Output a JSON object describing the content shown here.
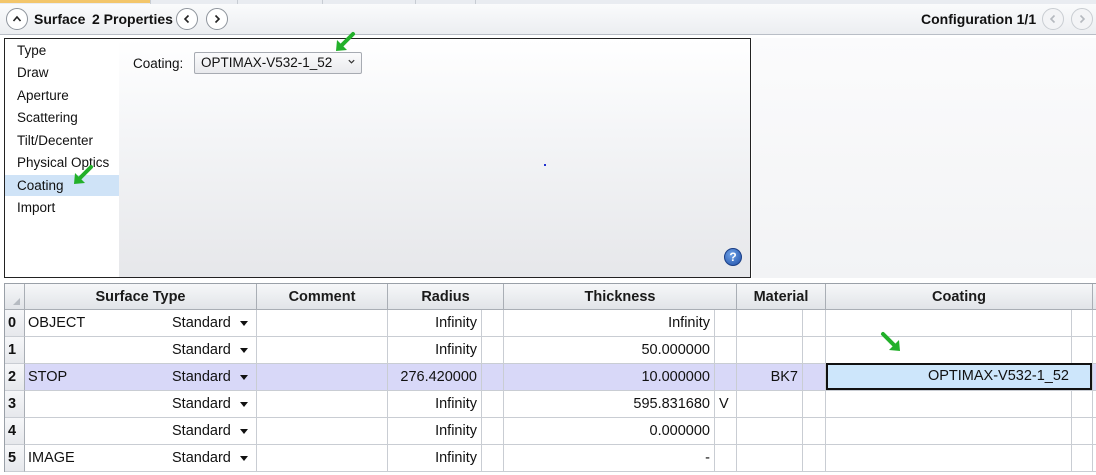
{
  "header": {
    "title": "Surface",
    "subtitle": "2 Properties",
    "configuration": "Configuration 1/1"
  },
  "nav": {
    "items": [
      "Type",
      "Draw",
      "Aperture",
      "Scattering",
      "Tilt/Decenter",
      "Physical Optics",
      "Coating",
      "Import"
    ],
    "selected": "Coating"
  },
  "coating_panel": {
    "label": "Coating:",
    "value": "OPTIMAX-V532-1_52",
    "help": "?"
  },
  "grid": {
    "columns": [
      "Surface Type",
      "Comment",
      "Radius",
      "Thickness",
      "Material",
      "Coating"
    ],
    "rows": [
      {
        "num": "0",
        "name": "OBJECT",
        "type": "Standard",
        "comment": "",
        "radius": "Infinity",
        "thickness": "Infinity",
        "solve": "",
        "material": "",
        "coating": ""
      },
      {
        "num": "1",
        "name": "",
        "type": "Standard",
        "comment": "",
        "radius": "Infinity",
        "thickness": "50.000000",
        "solve": "",
        "material": "",
        "coating": ""
      },
      {
        "num": "2",
        "name": "STOP",
        "type": "Standard",
        "comment": "",
        "radius": "276.420000",
        "thickness": "10.000000",
        "solve": "",
        "material": "BK7",
        "coating": "OPTIMAX-V532-1_52"
      },
      {
        "num": "3",
        "name": "",
        "type": "Standard",
        "comment": "",
        "radius": "Infinity",
        "thickness": "595.831680",
        "solve": "V",
        "material": "",
        "coating": ""
      },
      {
        "num": "4",
        "name": "",
        "type": "Standard",
        "comment": "",
        "radius": "Infinity",
        "thickness": "0.000000",
        "solve": "",
        "material": "",
        "coating": ""
      },
      {
        "num": "5",
        "name": "IMAGE",
        "type": "Standard",
        "comment": "",
        "radius": "Infinity",
        "thickness": "-",
        "solve": "",
        "material": "",
        "coating": ""
      }
    ]
  },
  "colors": {
    "accent_selection": "#cfe3f7",
    "row_highlight": "#d8d8f8",
    "active_cell": "#cde6fb",
    "annotation_arrow": "#22b02a"
  }
}
